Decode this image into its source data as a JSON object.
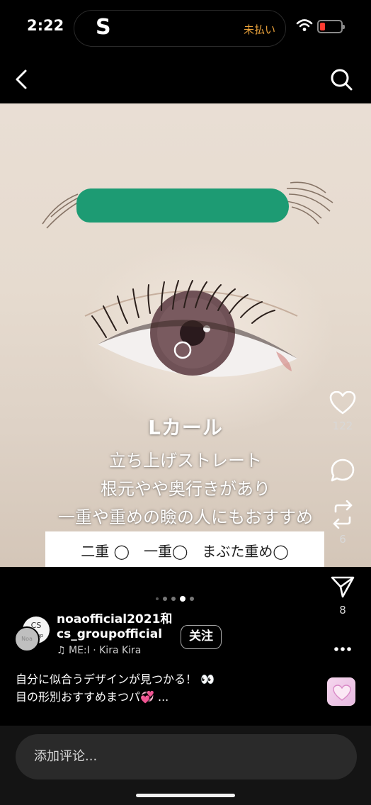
{
  "status": {
    "time": "2:22",
    "app_letter": "S",
    "unpaid_label": "未払い"
  },
  "post": {
    "overlay": {
      "title": "Lカール",
      "line1": "立ち上げストレート",
      "line2": "根元やや奥行きがあり",
      "line3": "一重や重めの瞼の人にもおすすめ",
      "band": "二重 ◯　一重◯　まぶた重め◯"
    },
    "likes": "122",
    "reposts": "6",
    "shares": "8",
    "carousel": {
      "total": 5,
      "active": 3
    }
  },
  "author": {
    "name_line1": "noaofficial2021和",
    "name_line2": "cs_groupofficial",
    "avatar1_text": "CS\ngroup",
    "avatar2_text": "Noa",
    "follow_label": "关注",
    "music": "♫ ME:I · Kira Kira"
  },
  "caption": {
    "line1": "自分に似合うデザインが見つかる！ 👀",
    "line2": "目の形別おすすめまつパ💞 ..."
  },
  "comment": {
    "placeholder": "添加评论..."
  },
  "colors": {
    "highlight_bar": "#1d9b73",
    "background": "#000000",
    "unpaid": "#e8a03a",
    "battery_low": "#ff3b30"
  }
}
